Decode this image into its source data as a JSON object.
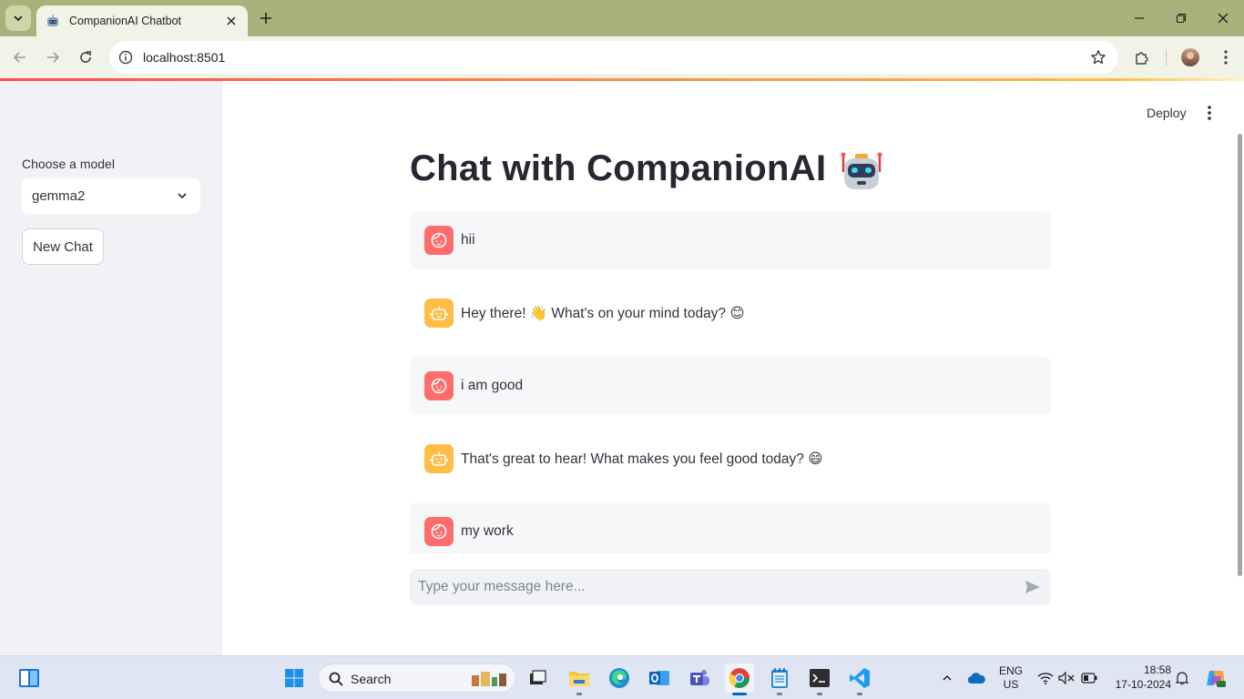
{
  "browser": {
    "tab_title": "CompanionAI Chatbot",
    "url": "localhost:8501"
  },
  "sidebar": {
    "model_label": "Choose a model",
    "model_selected": "gemma2",
    "new_chat_label": "New Chat"
  },
  "header": {
    "deploy_label": "Deploy"
  },
  "main": {
    "title": "Chat with CompanionAI",
    "messages": [
      {
        "role": "user",
        "text": "hii"
      },
      {
        "role": "assistant",
        "text": "Hey there! 👋 What's on your mind today? 😊"
      },
      {
        "role": "user",
        "text": "i am good"
      },
      {
        "role": "assistant",
        "text": "That's great to hear! What makes you feel good today? 😄"
      },
      {
        "role": "user",
        "text": "my work"
      }
    ],
    "input_placeholder": "Type your message here..."
  },
  "taskbar": {
    "search_label": "Search",
    "lang_line1": "ENG",
    "lang_line2": "US",
    "time": "18:58",
    "date": "17-10-2024"
  },
  "colors": {
    "accent": "#ff4b4b",
    "user_avatar": "#ff6c6c",
    "bot_avatar": "#ffbd45",
    "sidebar_bg": "#f0f2f6"
  }
}
